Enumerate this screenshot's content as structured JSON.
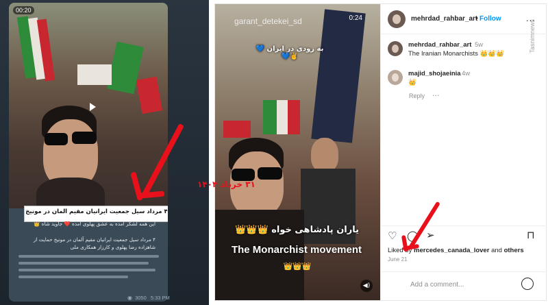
{
  "telegram": {
    "duration": "00:20",
    "caption_box": "۴ مرداد سیل جمعیت ایرانیان مقیم آلمان در مونیخ",
    "text_line1": "این همه لشکر آمده به عشق پهلوی آمده ❤️ جاوید شاه 👑",
    "text_line2": "۴ مرداد سیل جمعیت ایرانیان مقیم آلمان در مونیخ حمایت از شاهزاده رضا پهلوی و کارزار همکاری ملی",
    "views": "3050",
    "time": "5:33 PM",
    "view_icon": "eye-icon"
  },
  "instagram": {
    "watermark": "garant_detekei_sd",
    "video_time": "0:24",
    "overlay_top": "به زودی در ایران 💙✌️💙",
    "overlay_fa": "یاران پادشاهی خواه 👑👑👑",
    "overlay_en": "The Monarchist movement",
    "overlay_crowns": "👑👑👑",
    "header": {
      "username": "mehrdad_rahbar_art",
      "dot": "•",
      "follow": "Follow",
      "more": "..."
    },
    "comments": [
      {
        "user": "mehrdad_rahbar_art",
        "time": "5w",
        "text": "The Iranian Monarchists 👑👑👑"
      },
      {
        "user": "majid_shojaeinia",
        "time": "4w",
        "text": "👑"
      }
    ],
    "reply_label": "Reply",
    "likes_prefix": "Liked by",
    "likes_user": "mercedes_canada_lover",
    "likes_and": "and",
    "likes_others": "others",
    "date": "June 21",
    "comment_placeholder": "Add a comment...",
    "annotation_date": "۳۱ خرداد ۱۴۰۴"
  },
  "side_watermark": "Tasnimnews",
  "colors": {
    "arrow": "#e8111b",
    "follow": "#0095f6",
    "telegram_bg": "#1f2933"
  }
}
